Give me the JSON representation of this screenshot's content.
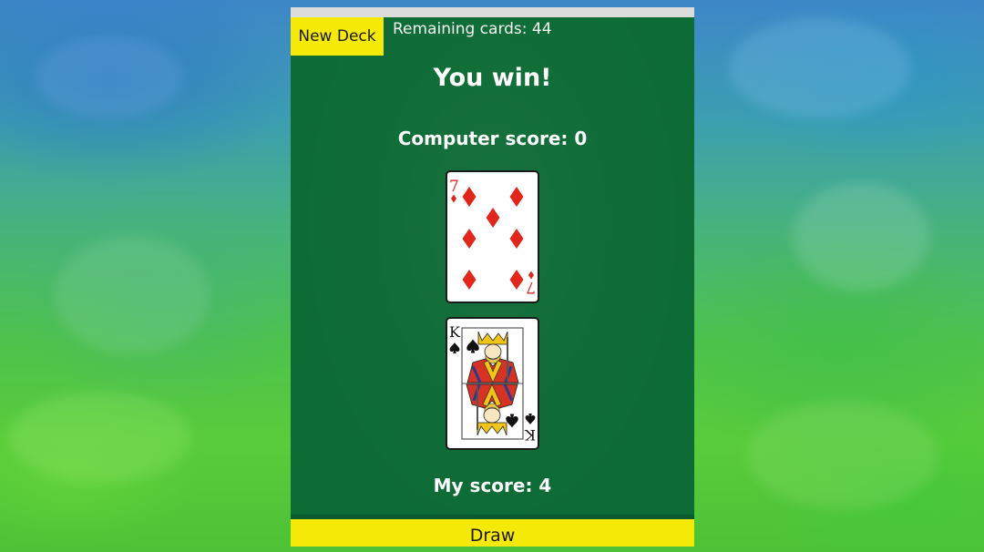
{
  "colors": {
    "table_green": "#0d6b35",
    "button_yellow": "#f5e907",
    "card_red": "#e1261c",
    "card_black": "#111111"
  },
  "controls": {
    "new_deck_label": "New Deck",
    "draw_label": "Draw"
  },
  "status": {
    "remaining_text": "Remaining cards: 44",
    "result_text": "You win!"
  },
  "scores": {
    "computer_text": "Computer score: 0",
    "player_text": "My score: 4"
  },
  "cards": {
    "computer": {
      "rank": "7",
      "suit": "diamonds",
      "icon": "seven-of-diamonds-card"
    },
    "player": {
      "rank": "K",
      "suit": "spades",
      "icon": "king-of-spades-card"
    }
  }
}
